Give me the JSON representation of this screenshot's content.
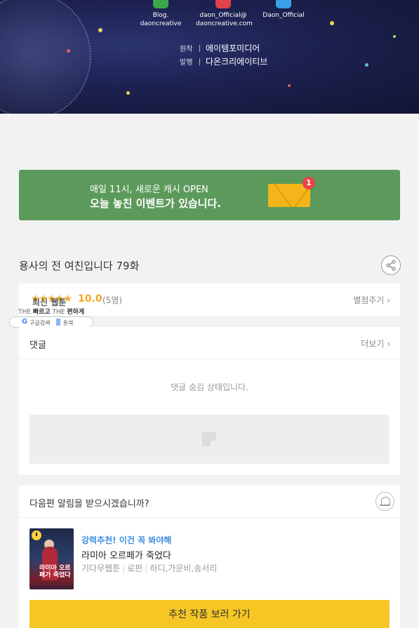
{
  "header": {
    "social": [
      {
        "icon": "blog-icon",
        "line1": "Blog.",
        "line2": "daoncreative",
        "color": "#3aa84a"
      },
      {
        "icon": "mail-icon",
        "line1": "daon_Official@",
        "line2": "daoncreative.com",
        "color": "#e0424a"
      },
      {
        "icon": "twitter-icon",
        "line1": "Daon_Official",
        "line2": "",
        "color": "#3aa0e8"
      }
    ],
    "credits": [
      {
        "key": "원작",
        "value": "에이템포미디어"
      },
      {
        "key": "발행",
        "value": "다온크리에이티브"
      }
    ]
  },
  "event_banner": {
    "line1": "매일 11시, 새로운 캐시 OPEN",
    "line2": "오늘 놓친 이벤트가 있습니다.",
    "badge": "1",
    "icon": "envelope-icon",
    "color": "#5c9a5c"
  },
  "episode": {
    "title": "용사의 전 여친입니다 79화",
    "share_icon": "share-icon"
  },
  "rating": {
    "stars": "★★★★★",
    "score": "10.0",
    "count": "(5명)",
    "rate_link": "별점주기",
    "chevron": "›"
  },
  "overlay": {
    "title": "최신 웹툰",
    "sub_the1": "THE",
    "sub_fast": "빠르고",
    "sub_the2": "THE",
    "sub_easy": "편하게",
    "pill_google": "G",
    "pill_google_label": "구글검색",
    "pill_toon_label": "툰북"
  },
  "comments": {
    "title": "댓글",
    "more": "더보기",
    "chevron": "›",
    "hidden_text": "댓글 숨김 상태입니다."
  },
  "recommend": {
    "question": "다음편 알림을 받으시겠습니까?",
    "bell_icon": "bell-icon",
    "tag": "강력추천! 이건 꼭 봐야해",
    "name": "라미아 오르페가 죽었다",
    "meta": [
      "기다무웹툰",
      "로판",
      "하디,가문비,송서리"
    ],
    "thumb_title": "라미아 오르페가 죽었다",
    "button": "추천 작품 보러 가기",
    "button_color": "#f5c624"
  }
}
